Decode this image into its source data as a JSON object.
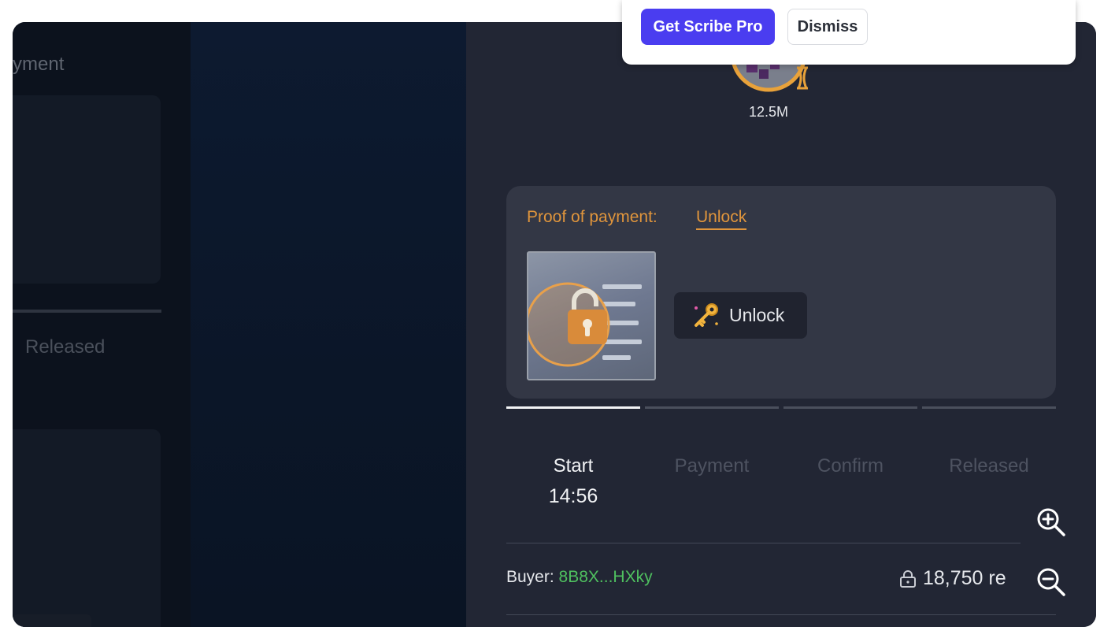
{
  "left_panel": {
    "title": "yment",
    "tab_released": "Released"
  },
  "banner": {
    "primary_button": "Get Scribe Pro",
    "dismiss_button": "Dismiss"
  },
  "avatar": {
    "count": "12.5M"
  },
  "proof": {
    "label": "Proof of payment:",
    "link": "Unlock",
    "unlock_button": "Unlock"
  },
  "steps": {
    "items": [
      "Start",
      "Payment",
      "Confirm",
      "Released"
    ],
    "active": "Start",
    "timer": "14:56"
  },
  "buyer": {
    "label": "Buyer:",
    "id": "8B8X...HXky"
  },
  "amount": {
    "value": "18,750 re"
  },
  "icons": {
    "lock": "lock-icon",
    "key": "key-icon",
    "zoom_in": "zoom-in-icon",
    "zoom_out": "zoom-out-icon"
  },
  "colors": {
    "brand_button": "#4a3df0",
    "proof_label": "#e0953c",
    "buyer_id": "#4fc05f",
    "panel_bg": "#222634",
    "card_bg": "#333745"
  }
}
